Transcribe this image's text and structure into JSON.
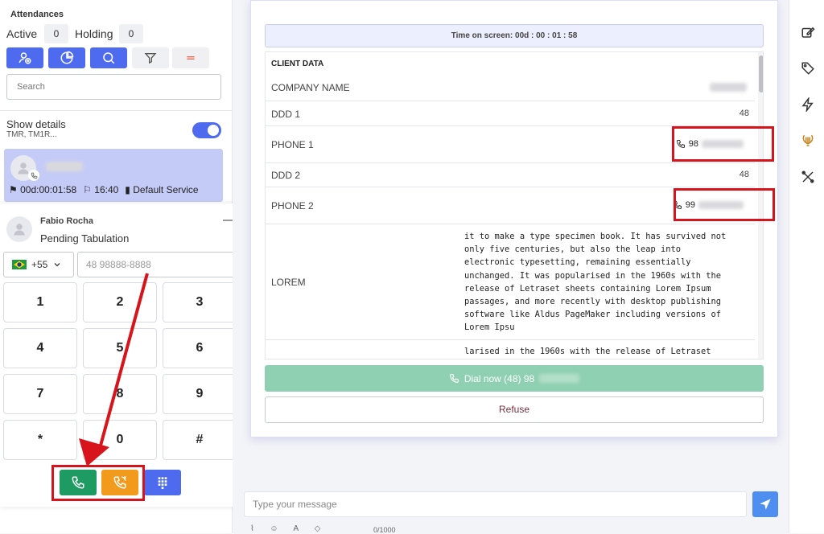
{
  "attendances": {
    "title": "Attendances",
    "active_label": "Active",
    "active_count": "0",
    "holding_label": "Holding",
    "holding_count": "0",
    "toolbar_icons": [
      "add-user-icon",
      "pie-chart-icon",
      "search-icon",
      "filter-icon",
      "menu-lines-icon"
    ],
    "search_placeholder": "Search",
    "show_details_label": "Show details",
    "show_details_sub": "TMR, TM1R...",
    "card": {
      "elapsed": "00d:00:01:58",
      "time": "16:40",
      "queue": "Default Service"
    }
  },
  "dialer": {
    "contact_name": "Fabio Rocha",
    "status": "Pending Tabulation",
    "minimize": "—",
    "country_code": "+55",
    "phone_placeholder": "48 98888-8888",
    "keys": [
      "1",
      "2",
      "3",
      "4",
      "5",
      "6",
      "7",
      "8",
      "9",
      "*",
      "0",
      "#"
    ]
  },
  "screen": {
    "time_on_screen": "Time on screen: 00d : 00 : 01 : 58",
    "client_data_header": "CLIENT DATA",
    "rows": {
      "company_name": "COMPANY NAME",
      "ddd1_label": "DDD 1",
      "ddd1_value": "48",
      "phone1_label": "PHONE 1",
      "phone1_prefix": "98",
      "ddd2_label": "DDD 2",
      "ddd2_value": "48",
      "phone2_label": "PHONE 2",
      "phone2_prefix": "99",
      "lorem_label": "LOREM",
      "lorem_text": "it to make a type specimen book. It has survived not\nonly five centuries, but also the leap into\nelectronic typesetting, remaining essentially\nunchanged. It was popularised in the 1960s with the\nrelease of Letraset sheets containing Lorem Ipsum\npassages, and more recently with desktop publishing\nsoftware like Aldus PageMaker including versions of\nLorem Ipsu",
      "lorem_text_2": "larised in the 1960s with the release of Letraset"
    },
    "dial_now": "Dial now (48)  98",
    "refuse": "Refuse",
    "message_placeholder": "Type your message",
    "char_counter": "0/1000"
  },
  "rail_icons": [
    "edit-icon",
    "tag-icon",
    "lightning-icon",
    "lyre-icon",
    "tools-icon"
  ],
  "colors": {
    "primary": "#4e6bf0",
    "call_green": "#1e9b62",
    "callback_orange": "#f29a1c",
    "dial_now_bg": "#8fd0b2",
    "highlight_red": "#d7141b"
  }
}
